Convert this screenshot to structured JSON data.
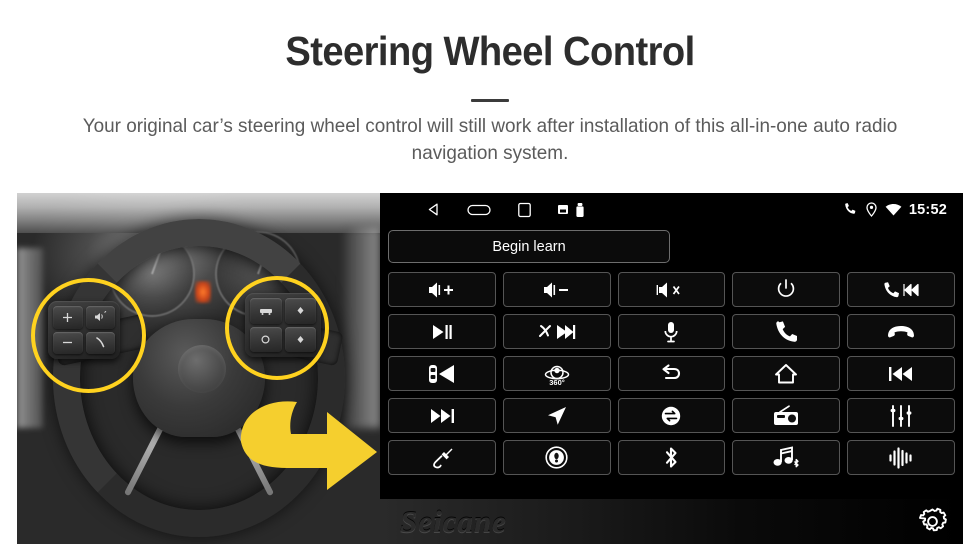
{
  "header": {
    "title": "Steering Wheel Control",
    "subtitle": "Your original car’s steering wheel control will still work after installation of this all-in-one auto radio navigation system."
  },
  "colors": {
    "accent_yellow": "#ffd21f",
    "title_dark": "#2d2d2d",
    "body_gray": "#5b5b5b",
    "screen_black": "#000000",
    "button_border": "#555555"
  },
  "photo": {
    "alt": "car-steering-wheel-with-control-buttons",
    "highlight_left": "left-control-pad-highlight",
    "highlight_right": "right-control-pad-highlight",
    "arrow": "yellow-pointing-arrow",
    "left_pad_keys": [
      "volume-up-plus",
      "mode-voice",
      "volume-down-minus",
      "phone-call"
    ],
    "right_pad_keys": [
      "cruise-set",
      "cruise-up",
      "cruise-cancel",
      "cruise-down"
    ]
  },
  "screen": {
    "statusbar": {
      "nav_icons": [
        "back-triangle-icon",
        "home-pill-icon",
        "recents-square-icon",
        "sd-card-icon",
        "usb-icon"
      ],
      "tray_icons": [
        "phone-icon",
        "location-pin-icon",
        "wifi-icon"
      ],
      "time": "15:52"
    },
    "begin_learn_label": "Begin learn",
    "buttons": [
      {
        "name": "volume-up-button",
        "icon": "volume-plus",
        "label": "Volume +"
      },
      {
        "name": "volume-down-button",
        "icon": "volume-minus",
        "label": "Volume −"
      },
      {
        "name": "mute-button",
        "icon": "volume-mute",
        "label": "Mute"
      },
      {
        "name": "power-button",
        "icon": "power",
        "label": "Power"
      },
      {
        "name": "call-previous-button",
        "icon": "phone-prev",
        "label": "Call / Prev"
      },
      {
        "name": "play-pause-button",
        "icon": "play-pause",
        "label": "Play / Pause"
      },
      {
        "name": "hangup-next-button",
        "icon": "hangup-next",
        "label": "Hang up / Next"
      },
      {
        "name": "voice-mic-button",
        "icon": "microphone",
        "label": "Voice"
      },
      {
        "name": "answer-call-button",
        "icon": "phone-answer",
        "label": "Answer"
      },
      {
        "name": "end-call-button",
        "icon": "phone-hangup",
        "label": "End call"
      },
      {
        "name": "parking-sensor-button",
        "icon": "car-speaker",
        "label": "Parking sensor"
      },
      {
        "name": "camera-360-button",
        "icon": "camera-360",
        "label": "360°"
      },
      {
        "name": "back-button",
        "icon": "back-arrow",
        "label": "Back"
      },
      {
        "name": "home-button",
        "icon": "home",
        "label": "Home"
      },
      {
        "name": "previous-track-button",
        "icon": "prev-track",
        "label": "Previous"
      },
      {
        "name": "next-track-button",
        "icon": "next-track",
        "label": "Next"
      },
      {
        "name": "navigation-button",
        "icon": "navigation",
        "label": "Navigation"
      },
      {
        "name": "source-swap-button",
        "icon": "source-swap",
        "label": "Source"
      },
      {
        "name": "radio-button",
        "icon": "radio",
        "label": "Radio"
      },
      {
        "name": "equalizer-button",
        "icon": "equalizer",
        "label": "Equalizer"
      },
      {
        "name": "aux-input-button",
        "icon": "aux-cable",
        "label": "AUX"
      },
      {
        "name": "disc-button",
        "icon": "disc",
        "label": "Disc"
      },
      {
        "name": "bluetooth-button",
        "icon": "bluetooth",
        "label": "Bluetooth"
      },
      {
        "name": "bluetooth-music-button",
        "icon": "bt-music",
        "label": "BT Music"
      },
      {
        "name": "voice-assistant-button",
        "icon": "waveform",
        "label": "Voice assistant"
      }
    ],
    "camera_360_label": "360°",
    "footer": {
      "brand": "Seicane",
      "settings_icon": "gear-icon"
    }
  }
}
